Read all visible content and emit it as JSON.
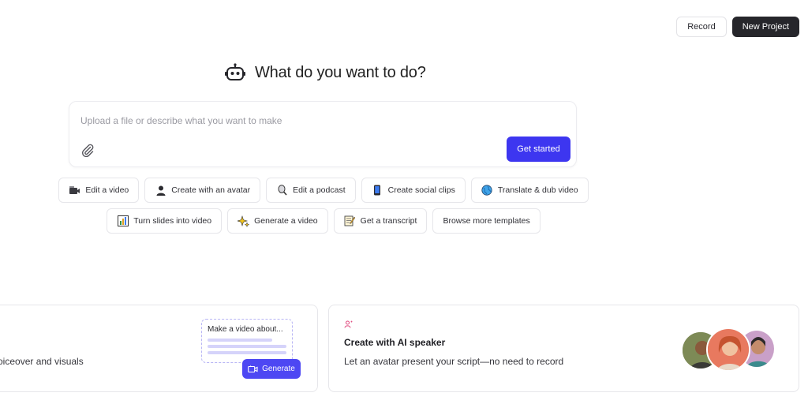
{
  "topbar": {
    "record_label": "Record",
    "new_project_label": "New Project"
  },
  "hero": {
    "title": "What do you want to do?"
  },
  "prompt": {
    "placeholder": "Upload a file or describe what you want to make",
    "submit_label": "Get started"
  },
  "chips_row1": [
    {
      "label": "Edit a video",
      "icon": "video-camera-icon"
    },
    {
      "label": "Create with an avatar",
      "icon": "person-icon"
    },
    {
      "label": "Edit a podcast",
      "icon": "microphone-icon"
    },
    {
      "label": "Create social clips",
      "icon": "phone-icon"
    },
    {
      "label": "Translate & dub video",
      "icon": "globe-icon"
    }
  ],
  "chips_row2": [
    {
      "label": "Turn slides into video",
      "icon": "chart-icon"
    },
    {
      "label": "Generate a video",
      "icon": "sparkles-icon"
    },
    {
      "label": "Get a transcript",
      "icon": "memo-icon"
    },
    {
      "label": "Browse more templates"
    }
  ],
  "card_left": {
    "subtitle": "voiceover and visuals",
    "mock_text": "Make a video about...",
    "generate_label": "Generate"
  },
  "card_right": {
    "title": "Create with AI speaker",
    "subtitle": "Let an avatar present your script—no need to record"
  },
  "colors": {
    "accent": "#3d36f0",
    "dark_button": "#26262b"
  }
}
